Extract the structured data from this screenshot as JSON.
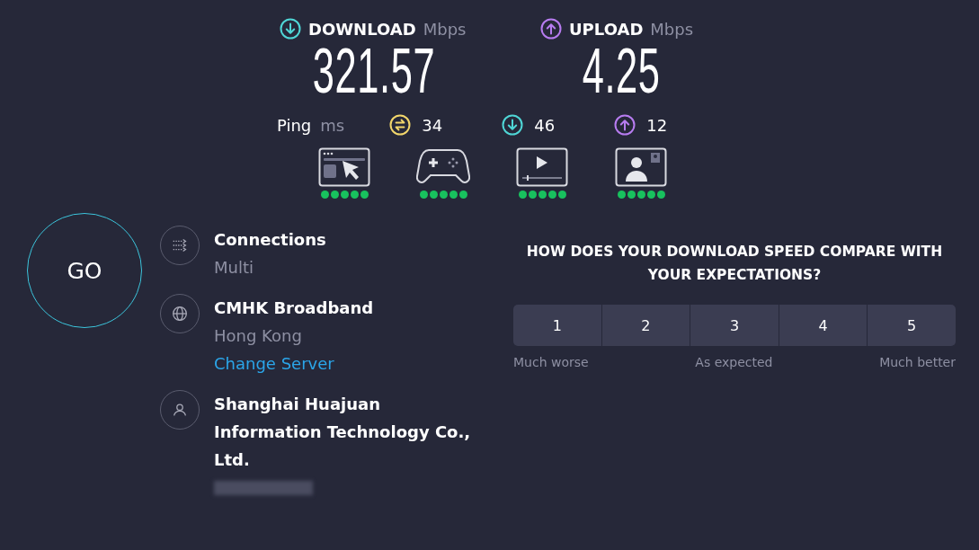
{
  "download": {
    "label": "DOWNLOAD",
    "unit": "Mbps",
    "value": "321.57"
  },
  "upload": {
    "label": "UPLOAD",
    "unit": "Mbps",
    "value": "4.25"
  },
  "ping": {
    "label": "Ping",
    "unit": "ms",
    "readings": [
      {
        "kind": "idle",
        "value": "34"
      },
      {
        "kind": "download",
        "value": "46"
      },
      {
        "kind": "upload",
        "value": "12"
      }
    ]
  },
  "quality": [
    {
      "kind": "browsing",
      "stars": 5
    },
    {
      "kind": "gaming",
      "stars": 5
    },
    {
      "kind": "streaming",
      "stars": 5
    },
    {
      "kind": "video_call",
      "stars": 5
    }
  ],
  "go_button": "GO",
  "info": [
    {
      "kind": "connections",
      "title": "Connections",
      "subtitle": "Multi"
    },
    {
      "kind": "server",
      "title": "CMHK Broadband",
      "subtitle": "Hong Kong",
      "link": "Change Server"
    },
    {
      "kind": "provider",
      "title": "Shanghai Huajuan Information Technology Co., Ltd.",
      "redacted": true
    }
  ],
  "survey": {
    "question": "HOW DOES YOUR DOWNLOAD SPEED COMPARE WITH YOUR EXPECTATIONS?",
    "options": [
      {
        "label": "1",
        "selected": false
      },
      {
        "label": "2",
        "selected": false
      },
      {
        "label": "3",
        "selected": false
      },
      {
        "label": "4",
        "selected": false
      },
      {
        "label": "5",
        "selected": false
      }
    ],
    "scale_labels": [
      "Much worse",
      "As expected",
      "Much better"
    ]
  }
}
